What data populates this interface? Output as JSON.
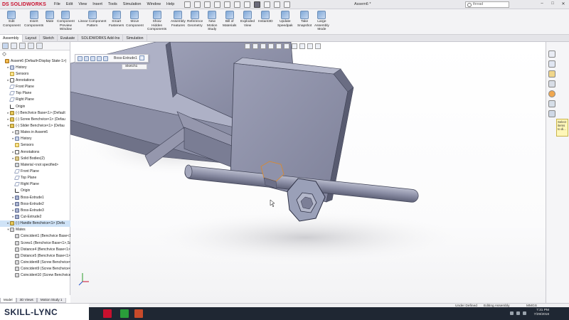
{
  "app": {
    "brand": "SOLIDWORKS",
    "brand_prefix": "DS",
    "menus": [
      "File",
      "Edit",
      "View",
      "Insert",
      "Tools",
      "Simulation",
      "Window",
      "Help"
    ],
    "document_title": "Assem6 *",
    "search_placeholder": "thread",
    "window_controls": [
      "–",
      "□",
      "✕"
    ]
  },
  "commands": [
    {
      "label": "Edit\nComponent",
      "icon": "edit-component-icon"
    },
    {
      "label": "Insert\nComponents",
      "icon": "insert-components-icon"
    },
    {
      "label": "Mate",
      "icon": "mate-icon"
    },
    {
      "label": "Component\nPreview\nWindow",
      "icon": "component-preview-icon"
    },
    {
      "label": "Linear Component\nPattern",
      "icon": "linear-pattern-icon"
    },
    {
      "label": "Smart\nFasteners",
      "icon": "smart-fasteners-icon"
    },
    {
      "label": "Move\nComponent",
      "icon": "move-component-icon"
    },
    {
      "label": "Show\nHidden\nComponents",
      "icon": "show-hidden-icon"
    },
    {
      "label": "Assembly\nFeatures",
      "icon": "assembly-features-icon"
    },
    {
      "label": "Reference\nGeometry",
      "icon": "reference-geometry-icon"
    },
    {
      "label": "New\nMotion\nStudy",
      "icon": "motion-study-icon"
    },
    {
      "label": "Bill of\nMaterials",
      "icon": "bom-icon"
    },
    {
      "label": "Exploded\nView",
      "icon": "exploded-view-icon"
    },
    {
      "label": "Instant3D",
      "icon": "instant3d-icon"
    },
    {
      "label": "Update\nSpeedpak",
      "icon": "speedpak-icon"
    },
    {
      "label": "Take\nSnapshot",
      "icon": "snapshot-icon"
    },
    {
      "label": "Large\nAssembly\nMode",
      "icon": "large-assembly-icon"
    }
  ],
  "tabs": [
    "Assembly",
    "Layout",
    "Sketch",
    "Evaluate",
    "SOLIDWORKS Add-Ins",
    "Simulation"
  ],
  "tree": [
    {
      "label": "Assem6  (Default<Display State-1>)",
      "icon": "asm",
      "twisty": ""
    },
    {
      "label": "History",
      "icon": "history",
      "twisty": "▸"
    },
    {
      "label": "Sensors",
      "icon": "sensor",
      "twisty": ""
    },
    {
      "label": "Annotations",
      "icon": "annot",
      "twisty": "▸"
    },
    {
      "label": "Front Plane",
      "icon": "plane",
      "twisty": ""
    },
    {
      "label": "Top Plane",
      "icon": "plane",
      "twisty": ""
    },
    {
      "label": "Right Plane",
      "icon": "plane",
      "twisty": ""
    },
    {
      "label": "Origin",
      "icon": "origin",
      "twisty": ""
    },
    {
      "label": "(-) Benchvice Base<1> (Default",
      "icon": "part",
      "twisty": "▸"
    },
    {
      "label": "(-) Screw Benchvice<1> (Defau",
      "icon": "part",
      "twisty": "▸"
    },
    {
      "label": "(-) Slider Benchvice<1> (Defau",
      "icon": "part",
      "twisty": "▾"
    },
    {
      "label": "Mates in Assem6",
      "icon": "mate",
      "twisty": "▸"
    },
    {
      "label": "History",
      "icon": "history",
      "twisty": "▸"
    },
    {
      "label": "Sensors",
      "icon": "sensor",
      "twisty": ""
    },
    {
      "label": "Annotations",
      "icon": "annot",
      "twisty": "▸"
    },
    {
      "label": "Solid Bodies(2)",
      "icon": "folder",
      "twisty": "▸"
    },
    {
      "label": "Material <not specified>",
      "icon": "material",
      "twisty": ""
    },
    {
      "label": "Front Plane",
      "icon": "plane",
      "twisty": ""
    },
    {
      "label": "Top Plane",
      "icon": "plane",
      "twisty": ""
    },
    {
      "label": "Right Plane",
      "icon": "plane",
      "twisty": ""
    },
    {
      "label": "Origin",
      "icon": "origin",
      "twisty": ""
    },
    {
      "label": "Boss-Extrude1",
      "icon": "feature",
      "twisty": "▸"
    },
    {
      "label": "Boss-Extrude2",
      "icon": "feature",
      "twisty": "▸"
    },
    {
      "label": "Boss-Extrude3",
      "icon": "feature",
      "twisty": "▸"
    },
    {
      "label": "Cut-Extrude2",
      "icon": "feature",
      "twisty": "▸"
    },
    {
      "label": "(-) Handle Benchvice<1> (Defa",
      "icon": "part",
      "twisty": "▸",
      "highlight": true
    },
    {
      "label": "Mates",
      "icon": "mate",
      "twisty": "▾"
    },
    {
      "label": "Coincident1 (Benchvice Base<1>",
      "icon": "mate",
      "twisty": ""
    },
    {
      "label": "Screw1 (Benchvice Base<1>,Scr",
      "icon": "mate",
      "twisty": ""
    },
    {
      "label": "Distance4 (Benchvice Base<1>,",
      "icon": "mate",
      "twisty": ""
    },
    {
      "label": "Distance5 (Benchvice Base<1>,",
      "icon": "mate",
      "twisty": ""
    },
    {
      "label": "Coincident8 (Screw Benchvice<",
      "icon": "mate",
      "twisty": ""
    },
    {
      "label": "Coincident9 (Screw Benchvice<",
      "icon": "mate",
      "twisty": ""
    },
    {
      "label": "Coincident10 (Screw Benchvice",
      "icon": "mate",
      "twisty": ""
    }
  ],
  "popup": {
    "feature_label": "Boss-Extrude1",
    "flyout_label": "Sketch1"
  },
  "taskpane_note": "Select items to di...",
  "bottom_tabs": [
    "Model",
    "3D Views",
    "Motion Study 1"
  ],
  "status": {
    "definition": "Under Defined",
    "mode": "Editing Assembly",
    "units": "MMGS"
  },
  "clock": {
    "time": "7:31 PM",
    "date": "7/29/2018"
  },
  "watermark": "SKILL-LYNC",
  "colors": {
    "brand": "#c8102e",
    "part_body": "#8a8da6",
    "selection": "#cfe3f7"
  }
}
